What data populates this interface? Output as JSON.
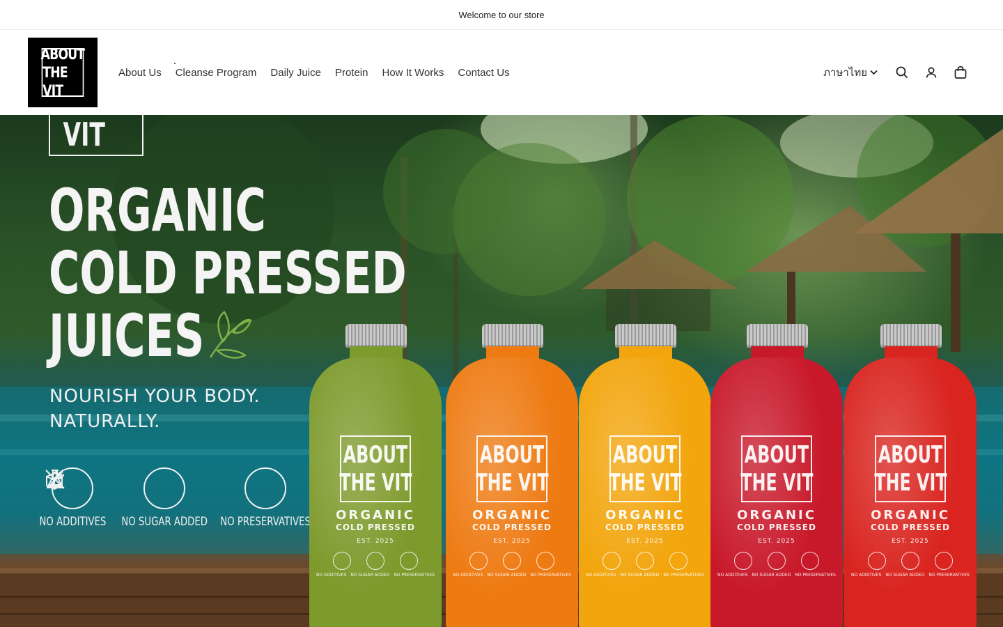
{
  "announcement": {
    "text": "Welcome to our store"
  },
  "logo": {
    "line1": "ABOUT",
    "line2": "THE VIT"
  },
  "nav": {
    "items": [
      {
        "label": "About Us"
      },
      {
        "label": "Cleanse Program"
      },
      {
        "label": "Daily Juice"
      },
      {
        "label": "Protein"
      },
      {
        "label": "How It Works"
      },
      {
        "label": "Contact Us"
      }
    ]
  },
  "header_right": {
    "language": "ภาษาไทย",
    "icons": [
      "search-icon",
      "account-icon",
      "cart-icon"
    ]
  },
  "hero": {
    "brand": "THE VIT",
    "headline": [
      "ORGANIC",
      "COLD PRESSED",
      "JUICES"
    ],
    "subline": [
      "NOURISH YOUR BODY.",
      "NATURALLY."
    ],
    "badges": [
      {
        "icon": "flask-icon",
        "label": "NO ADDITIVES"
      },
      {
        "icon": "sugar-cube-icon",
        "label": "NO SUGAR ADDED"
      },
      {
        "icon": "leaf-icon",
        "label": "NO PRESERVATIVES"
      }
    ],
    "bottle_label": {
      "line1": "ABOUT",
      "line2": "THE VIT",
      "organic": "ORGANIC",
      "cold_pressed": "COLD PRESSED",
      "est": "EST. 2025",
      "mini_labels": [
        "NO ADDITIVES",
        "NO SUGAR ADDED",
        "NO PRESERVATIVES"
      ]
    },
    "bottle_colors": [
      "#7d9a2c",
      "#ee7a12",
      "#f2a50c",
      "#c8192a",
      "#d9241f"
    ]
  }
}
